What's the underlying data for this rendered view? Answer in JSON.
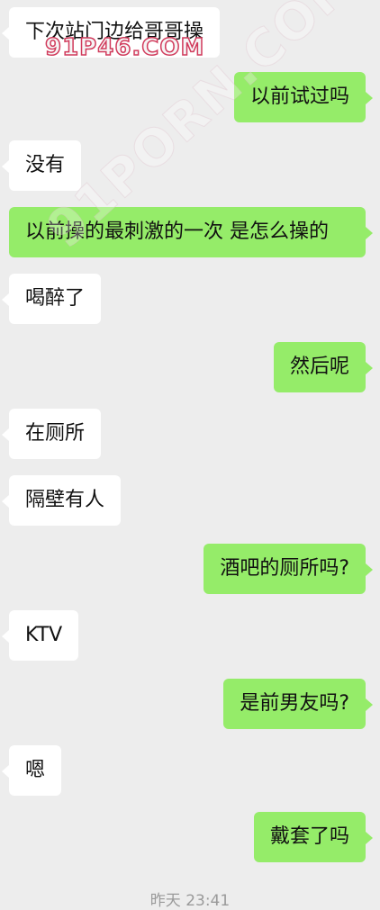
{
  "messages": [
    {
      "side": "left",
      "text": "下次站门边给哥哥操"
    },
    {
      "side": "right",
      "text": "以前试过吗"
    },
    {
      "side": "left",
      "text": "没有"
    },
    {
      "side": "right",
      "text": "以前操的最刺激的一次 是怎么操的"
    },
    {
      "side": "left",
      "text": "喝醉了"
    },
    {
      "side": "right",
      "text": "然后呢"
    },
    {
      "side": "left",
      "text": "在厕所"
    },
    {
      "side": "left",
      "text": "隔壁有人"
    },
    {
      "side": "right",
      "text": "酒吧的厕所吗?"
    },
    {
      "side": "left",
      "text": "KTV"
    },
    {
      "side": "right",
      "text": "是前男友吗?"
    },
    {
      "side": "left",
      "text": "嗯"
    },
    {
      "side": "right",
      "text": "戴套了吗"
    }
  ],
  "timestamp": "昨天 23:41",
  "watermark_top": "91P46.COM",
  "watermark_diag": "91PORN.COM",
  "colors": {
    "background": "#ededed",
    "incoming_bubble": "#ffffff",
    "outgoing_bubble": "#95ec69",
    "timestamp_text": "#9a9a9a"
  }
}
